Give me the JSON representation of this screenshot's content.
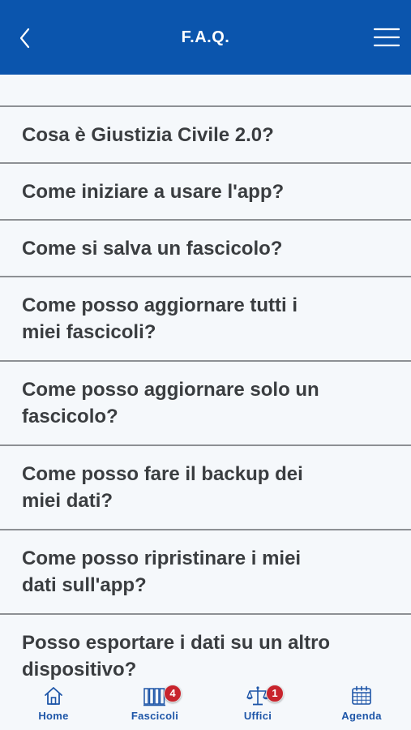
{
  "header": {
    "title": "F.A.Q.",
    "background_color": "#0b55ad",
    "back_icon": "chevron-left-icon",
    "menu_icon": "hamburger-menu-icon"
  },
  "faq": {
    "items": [
      "Cosa è Giustizia Civile 2.0?",
      "Come iniziare a usare l'app?",
      "Come si salva un fascicolo?",
      "Come posso aggiornare tutti i miei fascicoli?",
      "Come posso aggiornare solo un fascicolo?",
      "Come posso fare il backup dei miei dati?",
      "Come posso ripristinare i miei dati sull'app?",
      "Posso esportare i dati su un altro dispositivo?"
    ]
  },
  "tabbar": {
    "tabs": [
      {
        "label": "Home",
        "icon": "home-icon"
      },
      {
        "label": "Fascicoli",
        "icon": "folders-icon",
        "badge": "4"
      },
      {
        "label": "Uffici",
        "icon": "scales-icon",
        "badge": "1"
      },
      {
        "label": "Agenda",
        "icon": "calendar-icon"
      }
    ],
    "accent_color": "#1e56a8",
    "badge_color": "#c8242d"
  }
}
